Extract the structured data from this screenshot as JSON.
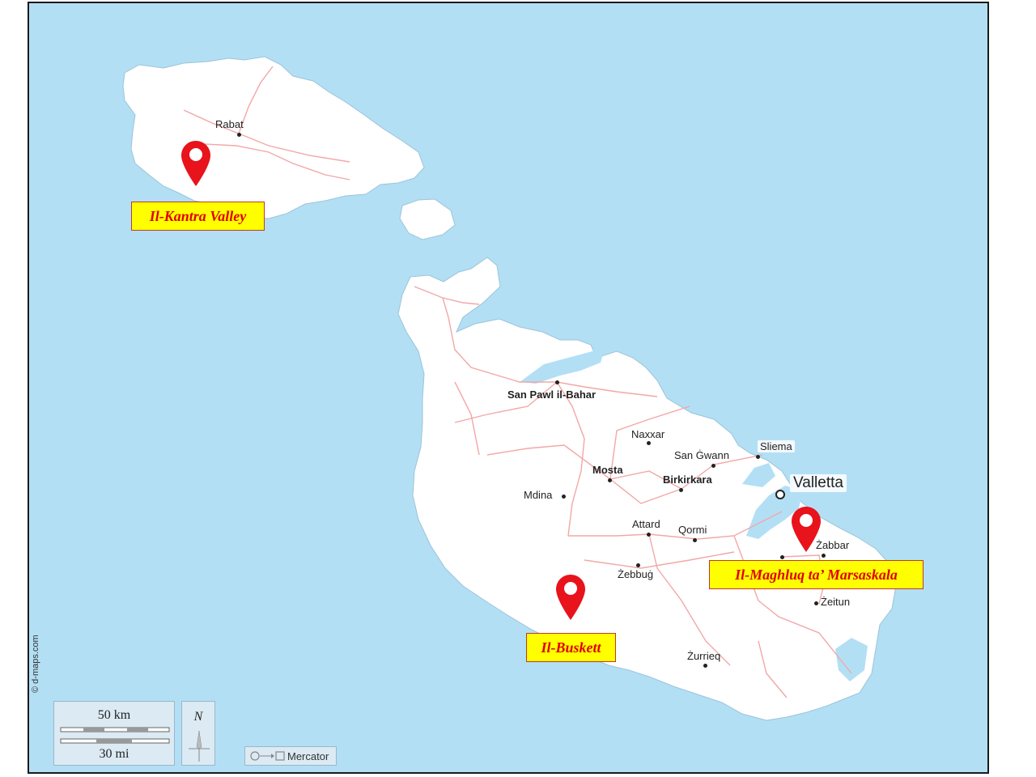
{
  "map": {
    "credit": "© d-maps.com",
    "projection": "Mercator",
    "colors": {
      "sea": "#b3dff5",
      "land": "#ffffff",
      "roads": "#f2a7a7",
      "pin": "#e8131b",
      "callout_bg": "#ffff00",
      "callout_text": "#e00000"
    }
  },
  "scale_bar": {
    "km_label": "50 km",
    "mi_label": "30 mi"
  },
  "north_arrow": {
    "label": "N"
  },
  "capital": {
    "name": "Valletta"
  },
  "towns": [
    {
      "id": "rabat",
      "name": "Rabat",
      "bold": false
    },
    {
      "id": "san-pawl",
      "name": "San Pawl il-Bahar",
      "bold": true
    },
    {
      "id": "naxxar",
      "name": "Naxxar",
      "bold": false
    },
    {
      "id": "san-gwann",
      "name": "San Ġwann",
      "bold": false
    },
    {
      "id": "sliema",
      "name": "Sliema",
      "bold": false
    },
    {
      "id": "mosta",
      "name": "Mosta",
      "bold": true
    },
    {
      "id": "birkirkara",
      "name": "Birkirkara",
      "bold": true
    },
    {
      "id": "mdina",
      "name": "Mdina",
      "bold": false
    },
    {
      "id": "attard",
      "name": "Attard",
      "bold": false
    },
    {
      "id": "qormi",
      "name": "Qormi",
      "bold": false
    },
    {
      "id": "zabbar",
      "name": "Żabbar",
      "bold": false
    },
    {
      "id": "zebbug",
      "name": "Żebbuġ",
      "bold": false
    },
    {
      "id": "zeitun",
      "name": "Żeitun",
      "bold": false
    },
    {
      "id": "zurrieq",
      "name": "Żurrieq",
      "bold": false
    }
  ],
  "markers": [
    {
      "id": "kantra",
      "label": "Il-Kantra Valley"
    },
    {
      "id": "buskett",
      "label": "Il-Buskett"
    },
    {
      "id": "maghluq",
      "label": "Il-Maghluq ta’ Marsaskala"
    }
  ]
}
